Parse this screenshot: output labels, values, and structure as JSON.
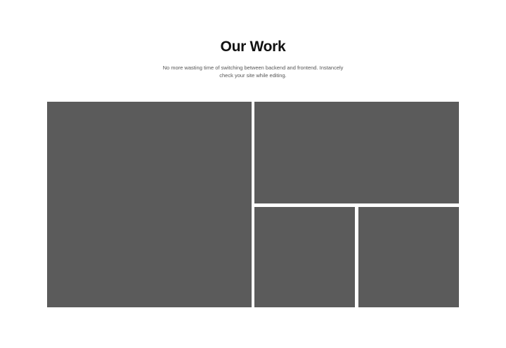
{
  "section": {
    "title": "Our Work",
    "subtitle": "No more wasting time of switching between backend and frontend. Instancely check your site while editing."
  },
  "colors": {
    "background": "#ffffff",
    "title": "#111111",
    "subtitle": "#555555",
    "tile_placeholder": "#5b5b5b"
  },
  "gallery": {
    "items": [
      {
        "name": "portfolio-item-1"
      },
      {
        "name": "portfolio-item-2"
      },
      {
        "name": "portfolio-item-3"
      },
      {
        "name": "portfolio-item-4"
      }
    ]
  }
}
